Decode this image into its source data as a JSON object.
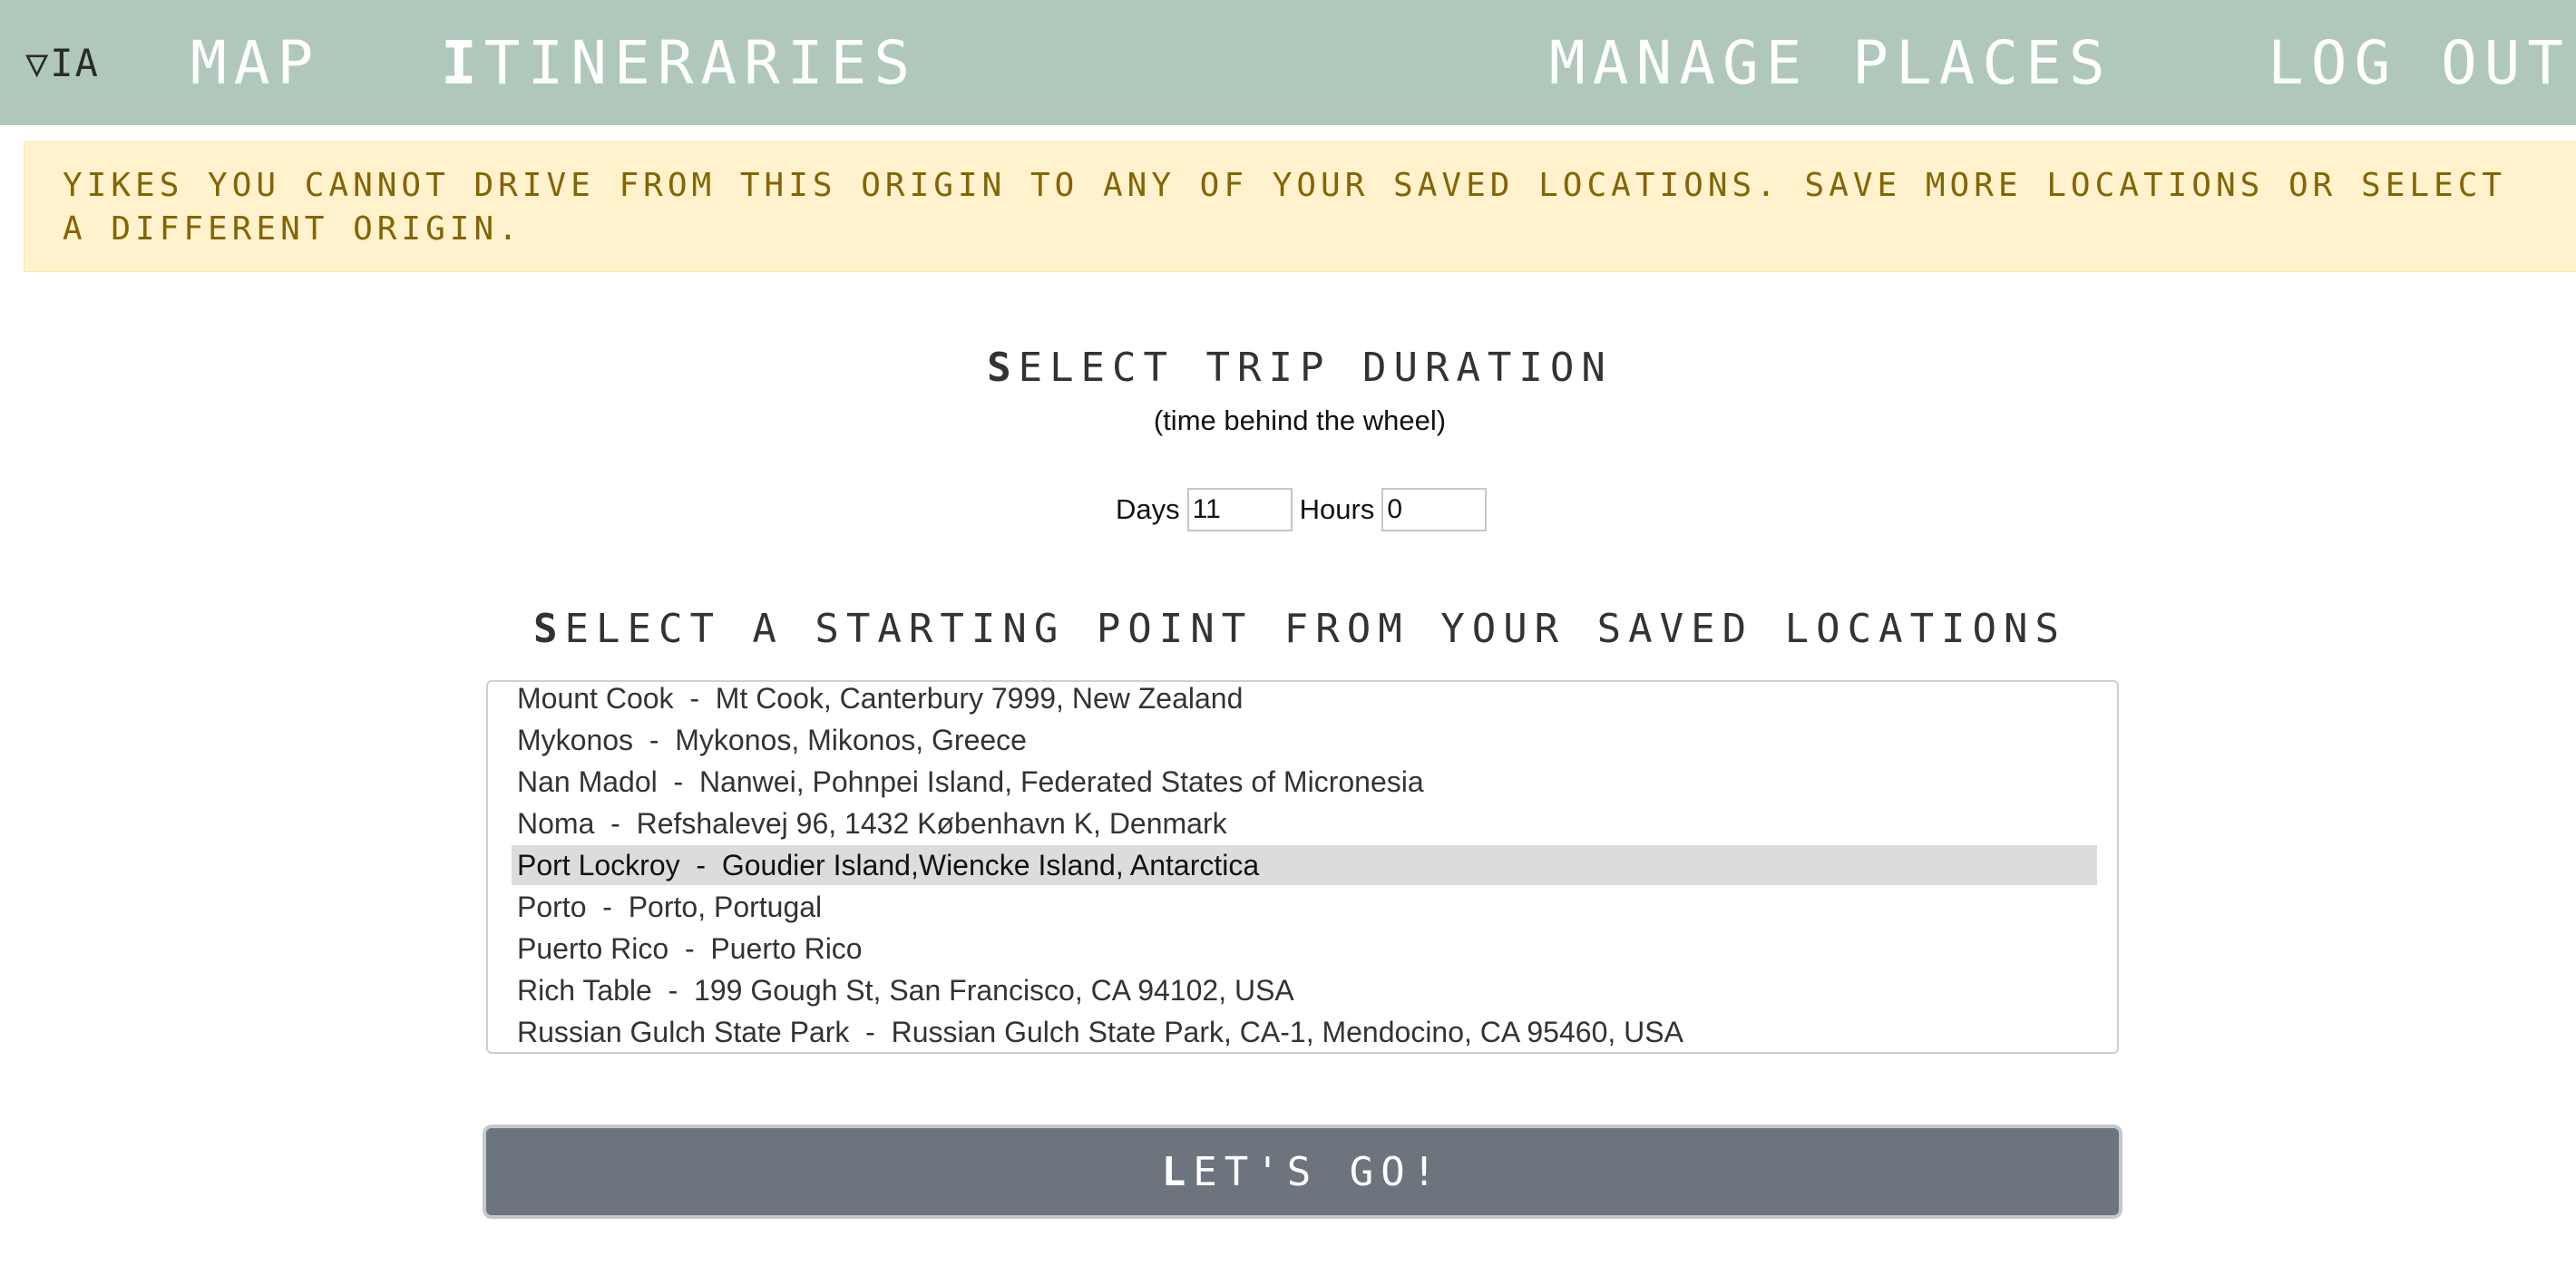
{
  "nav": {
    "brand": "▽IA",
    "map": "MAP",
    "itineraries": "ITINERARIES",
    "manage_places": "MANAGE PLACES",
    "log_out": "LOG OUT"
  },
  "alert": {
    "text": "YIKES YOU CANNOT DRIVE FROM THIS ORIGIN TO ANY OF YOUR SAVED LOCATIONS. SAVE MORE LOCATIONS OR SELECT A DIFFERENT ORIGIN."
  },
  "duration": {
    "title": "SELECT TRIP DURATION",
    "subtitle": "(time behind the wheel)",
    "days_label": "Days",
    "days_value": "11",
    "hours_label": "Hours",
    "hours_value": "0"
  },
  "start": {
    "title": "SELECT A STARTING POINT FROM YOUR SAVED LOCATIONS",
    "options": [
      "Mount Cook  -  Mt Cook, Canterbury 7999, New Zealand",
      "Mykonos  -  Mykonos, Mikonos, Greece",
      "Nan Madol  -  Nanwei, Pohnpei Island, Federated States of Micronesia",
      "Noma  -  Refshalevej 96, 1432 København K, Denmark",
      "Port Lockroy  -  Goudier Island,Wiencke Island, Antarctica",
      "Porto  -  Porto, Portugal",
      "Puerto Rico  -  Puerto Rico",
      "Rich Table  -  199 Gough St, San Francisco, CA 94102, USA",
      "Russian Gulch State Park  -  Russian Gulch State Park, CA-1, Mendocino, CA 95460, USA"
    ],
    "selected": "Port Lockroy  -  Goudier Island,Wiencke Island, Antarctica"
  },
  "go_button": "LET'S GO!",
  "colors": {
    "navbar": "#b0c8bc",
    "alert_bg": "#fff2cc",
    "alert_text": "#856404",
    "button": "#6c757d"
  }
}
